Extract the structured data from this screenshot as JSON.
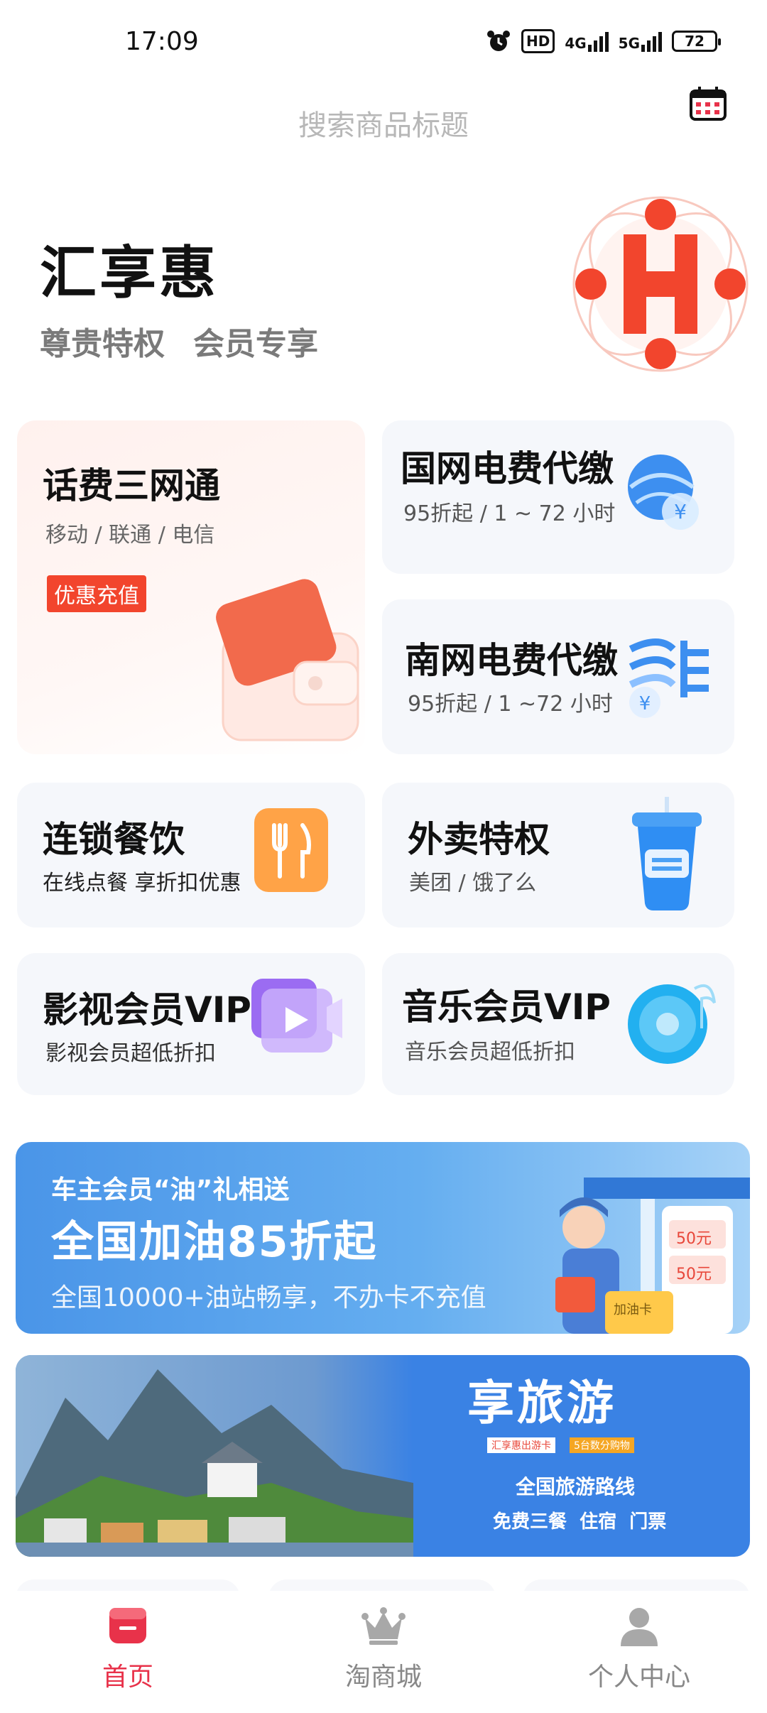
{
  "status_bar": {
    "time": "17:09",
    "hd_badge": "HD",
    "net1": "4G",
    "net2": "5G",
    "battery": "72"
  },
  "search": {
    "placeholder": "搜索商品标题"
  },
  "hero": {
    "title": "汇享惠",
    "subtitle_1": "尊贵特权",
    "subtitle_2": "会员专享"
  },
  "cards": {
    "phone": {
      "title": "话费三网通",
      "sub": "移动 / 联通 / 电信",
      "tag": "优惠充值"
    },
    "state_grid": {
      "title": "国网电费代缴",
      "sub": "95折起 / 1 ~ 72 小时"
    },
    "south_grid": {
      "title": "南网电费代缴",
      "sub": "95折起 / 1 ~72 小时"
    },
    "chain_dining": {
      "title": "连锁餐饮",
      "sub": "在线点餐  享折扣优惠"
    },
    "takeout": {
      "title": "外卖特权",
      "sub": "美团 / 饿了么"
    },
    "video_vip": {
      "title": "影视会员VIP",
      "sub": "影视会员超低折扣"
    },
    "music_vip": {
      "title": "音乐会员VIP",
      "sub": "音乐会员超低折扣"
    }
  },
  "banner_fuel": {
    "line1": "车主会员“油”礼相送",
    "line2": "全国加油85折起",
    "line3": "全国10000+油站畅享，不办卡不充值",
    "pump_label_1": "50元",
    "pump_label_2": "50元",
    "card_label": "加油卡"
  },
  "banner_travel": {
    "title": "享旅游",
    "badge_left": "汇享惠出游卡",
    "badge_right": "5台数分购物",
    "line1": "全国旅游路线",
    "line2": "免费三餐  住宿  门票"
  },
  "nav": {
    "home": "首页",
    "mall": "淘商城",
    "profile": "个人中心"
  },
  "colors": {
    "accent": "#e8324a",
    "tag_red": "#f2452d",
    "banner_blue": "#4a95e8"
  }
}
